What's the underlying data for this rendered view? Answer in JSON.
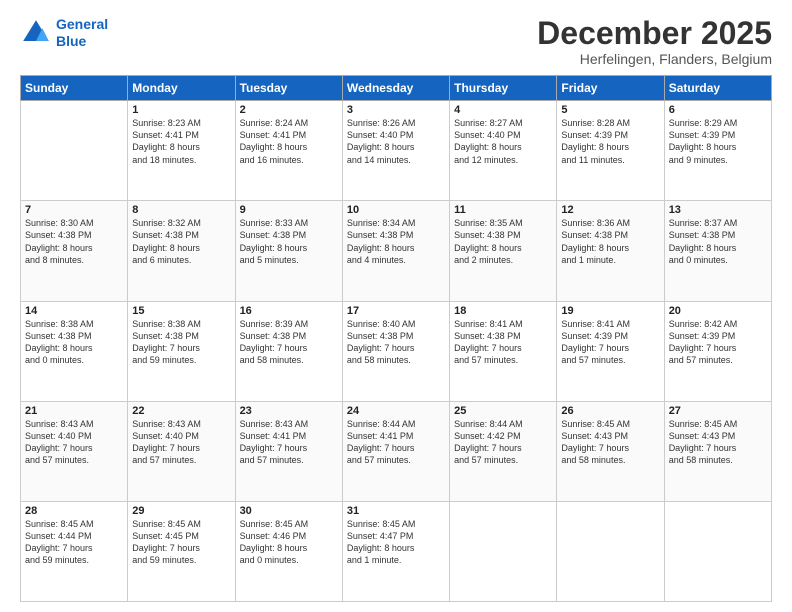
{
  "logo": {
    "line1": "General",
    "line2": "Blue"
  },
  "header": {
    "month": "December 2025",
    "location": "Herfelingen, Flanders, Belgium"
  },
  "weekdays": [
    "Sunday",
    "Monday",
    "Tuesday",
    "Wednesday",
    "Thursday",
    "Friday",
    "Saturday"
  ],
  "weeks": [
    [
      {
        "day": "",
        "info": ""
      },
      {
        "day": "1",
        "info": "Sunrise: 8:23 AM\nSunset: 4:41 PM\nDaylight: 8 hours\nand 18 minutes."
      },
      {
        "day": "2",
        "info": "Sunrise: 8:24 AM\nSunset: 4:41 PM\nDaylight: 8 hours\nand 16 minutes."
      },
      {
        "day": "3",
        "info": "Sunrise: 8:26 AM\nSunset: 4:40 PM\nDaylight: 8 hours\nand 14 minutes."
      },
      {
        "day": "4",
        "info": "Sunrise: 8:27 AM\nSunset: 4:40 PM\nDaylight: 8 hours\nand 12 minutes."
      },
      {
        "day": "5",
        "info": "Sunrise: 8:28 AM\nSunset: 4:39 PM\nDaylight: 8 hours\nand 11 minutes."
      },
      {
        "day": "6",
        "info": "Sunrise: 8:29 AM\nSunset: 4:39 PM\nDaylight: 8 hours\nand 9 minutes."
      }
    ],
    [
      {
        "day": "7",
        "info": "Sunrise: 8:30 AM\nSunset: 4:38 PM\nDaylight: 8 hours\nand 8 minutes."
      },
      {
        "day": "8",
        "info": "Sunrise: 8:32 AM\nSunset: 4:38 PM\nDaylight: 8 hours\nand 6 minutes."
      },
      {
        "day": "9",
        "info": "Sunrise: 8:33 AM\nSunset: 4:38 PM\nDaylight: 8 hours\nand 5 minutes."
      },
      {
        "day": "10",
        "info": "Sunrise: 8:34 AM\nSunset: 4:38 PM\nDaylight: 8 hours\nand 4 minutes."
      },
      {
        "day": "11",
        "info": "Sunrise: 8:35 AM\nSunset: 4:38 PM\nDaylight: 8 hours\nand 2 minutes."
      },
      {
        "day": "12",
        "info": "Sunrise: 8:36 AM\nSunset: 4:38 PM\nDaylight: 8 hours\nand 1 minute."
      },
      {
        "day": "13",
        "info": "Sunrise: 8:37 AM\nSunset: 4:38 PM\nDaylight: 8 hours\nand 0 minutes."
      }
    ],
    [
      {
        "day": "14",
        "info": "Sunrise: 8:38 AM\nSunset: 4:38 PM\nDaylight: 8 hours\nand 0 minutes."
      },
      {
        "day": "15",
        "info": "Sunrise: 8:38 AM\nSunset: 4:38 PM\nDaylight: 7 hours\nand 59 minutes."
      },
      {
        "day": "16",
        "info": "Sunrise: 8:39 AM\nSunset: 4:38 PM\nDaylight: 7 hours\nand 58 minutes."
      },
      {
        "day": "17",
        "info": "Sunrise: 8:40 AM\nSunset: 4:38 PM\nDaylight: 7 hours\nand 58 minutes."
      },
      {
        "day": "18",
        "info": "Sunrise: 8:41 AM\nSunset: 4:38 PM\nDaylight: 7 hours\nand 57 minutes."
      },
      {
        "day": "19",
        "info": "Sunrise: 8:41 AM\nSunset: 4:39 PM\nDaylight: 7 hours\nand 57 minutes."
      },
      {
        "day": "20",
        "info": "Sunrise: 8:42 AM\nSunset: 4:39 PM\nDaylight: 7 hours\nand 57 minutes."
      }
    ],
    [
      {
        "day": "21",
        "info": "Sunrise: 8:43 AM\nSunset: 4:40 PM\nDaylight: 7 hours\nand 57 minutes."
      },
      {
        "day": "22",
        "info": "Sunrise: 8:43 AM\nSunset: 4:40 PM\nDaylight: 7 hours\nand 57 minutes."
      },
      {
        "day": "23",
        "info": "Sunrise: 8:43 AM\nSunset: 4:41 PM\nDaylight: 7 hours\nand 57 minutes."
      },
      {
        "day": "24",
        "info": "Sunrise: 8:44 AM\nSunset: 4:41 PM\nDaylight: 7 hours\nand 57 minutes."
      },
      {
        "day": "25",
        "info": "Sunrise: 8:44 AM\nSunset: 4:42 PM\nDaylight: 7 hours\nand 57 minutes."
      },
      {
        "day": "26",
        "info": "Sunrise: 8:45 AM\nSunset: 4:43 PM\nDaylight: 7 hours\nand 58 minutes."
      },
      {
        "day": "27",
        "info": "Sunrise: 8:45 AM\nSunset: 4:43 PM\nDaylight: 7 hours\nand 58 minutes."
      }
    ],
    [
      {
        "day": "28",
        "info": "Sunrise: 8:45 AM\nSunset: 4:44 PM\nDaylight: 7 hours\nand 59 minutes."
      },
      {
        "day": "29",
        "info": "Sunrise: 8:45 AM\nSunset: 4:45 PM\nDaylight: 7 hours\nand 59 minutes."
      },
      {
        "day": "30",
        "info": "Sunrise: 8:45 AM\nSunset: 4:46 PM\nDaylight: 8 hours\nand 0 minutes."
      },
      {
        "day": "31",
        "info": "Sunrise: 8:45 AM\nSunset: 4:47 PM\nDaylight: 8 hours\nand 1 minute."
      },
      {
        "day": "",
        "info": ""
      },
      {
        "day": "",
        "info": ""
      },
      {
        "day": "",
        "info": ""
      }
    ]
  ]
}
